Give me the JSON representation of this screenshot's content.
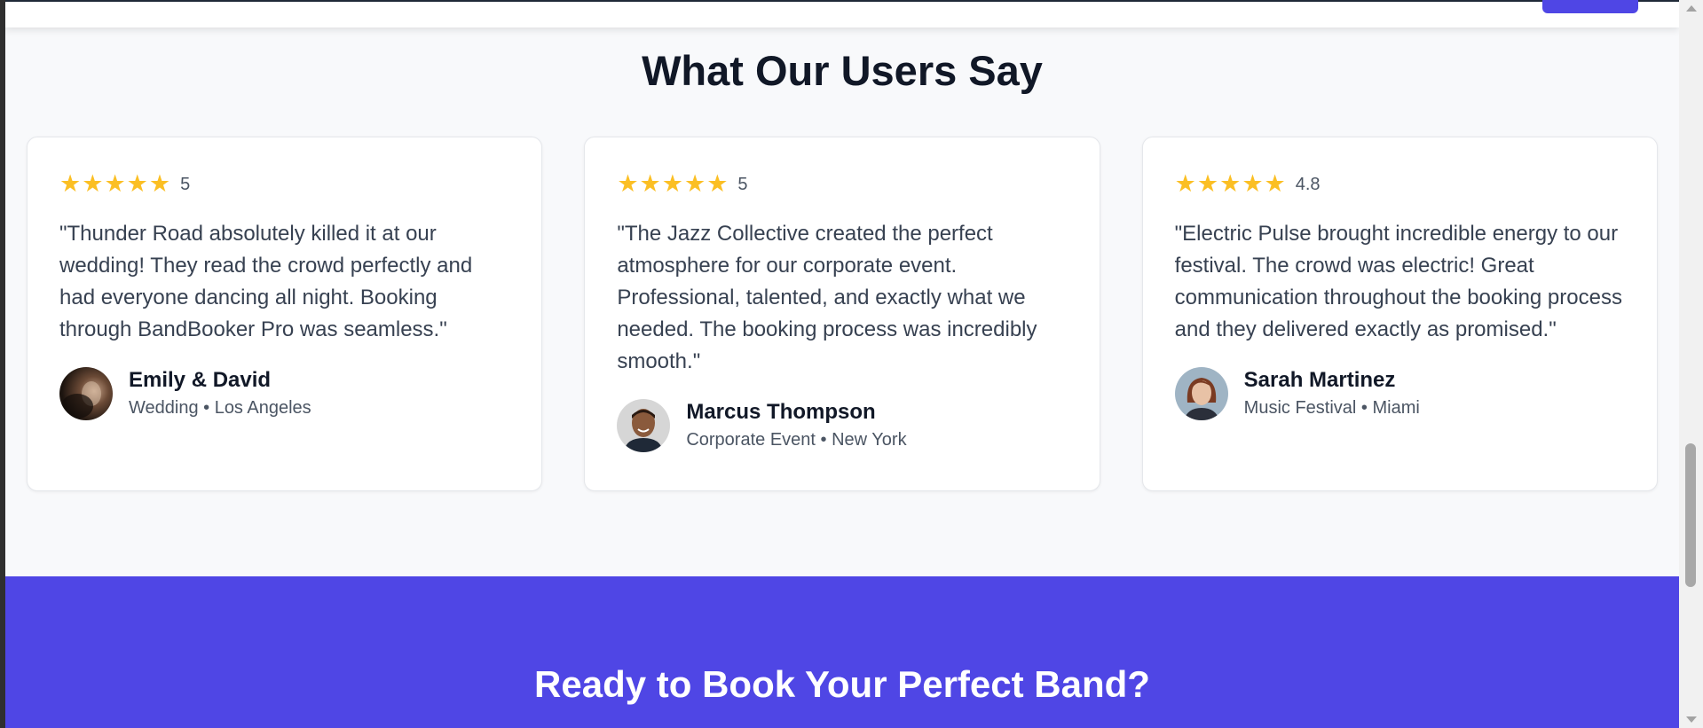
{
  "testimonials": {
    "title": "What Our Users Say",
    "star_glyph": "★",
    "items": [
      {
        "rating": "5",
        "quote": "\"Thunder Road absolutely killed it at our wedding! They read the crowd perfectly and had everyone dancing all night. Booking through BandBooker Pro was seamless.\"",
        "name": "Emily & David",
        "meta": "Wedding • Los Angeles"
      },
      {
        "rating": "5",
        "quote": "\"The Jazz Collective created the perfect atmosphere for our corporate event. Professional, talented, and exactly what we needed. The booking process was incredibly smooth.\"",
        "name": "Marcus Thompson",
        "meta": "Corporate Event • New York"
      },
      {
        "rating": "4.8",
        "quote": "\"Electric Pulse brought incredible energy to our festival. The crowd was electric! Great communication throughout the booking process and they delivered exactly as promised.\"",
        "name": "Sarah Martinez",
        "meta": "Music Festival • Miami"
      }
    ]
  },
  "cta": {
    "title": "Ready to Book Your Perfect Band?"
  },
  "colors": {
    "accent": "#4f46e5",
    "star": "#fbbf24",
    "heading": "#111827",
    "body_text": "#374151",
    "muted_text": "#4b5563"
  }
}
